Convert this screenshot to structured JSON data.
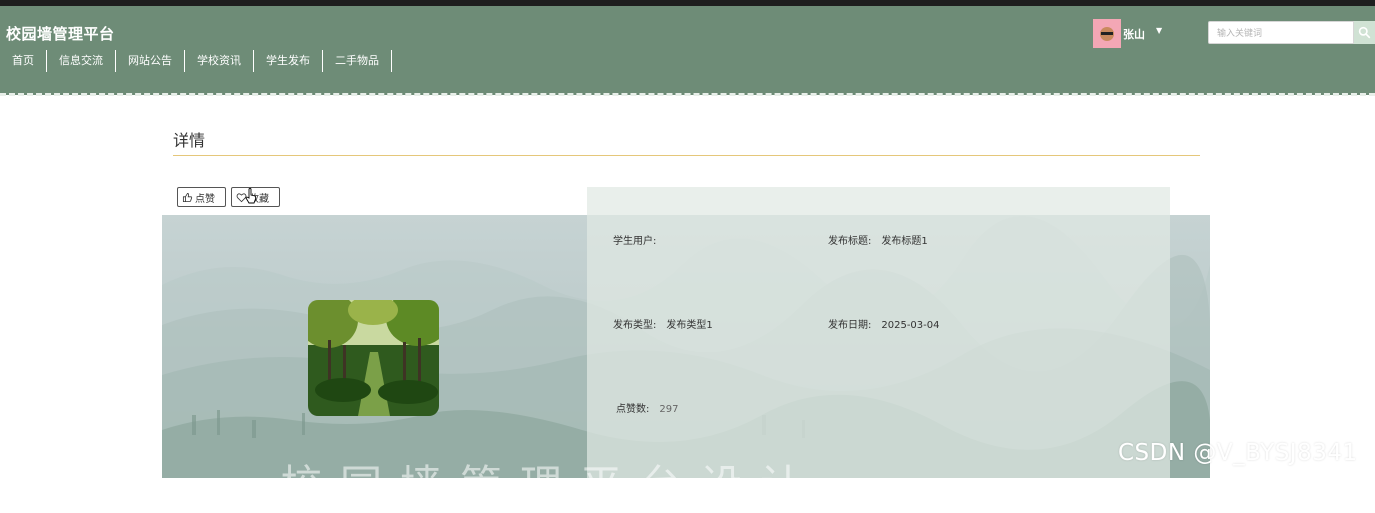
{
  "header": {
    "site_title": "校园墙管理平台",
    "nav": [
      "首页",
      "信息交流",
      "网站公告",
      "学校资讯",
      "学生发布",
      "二手物品"
    ],
    "user": {
      "name": "张山",
      "avatar_color": "#f3a7b5"
    },
    "search": {
      "placeholder": "输入关键词"
    },
    "background_color": "#6e8c77"
  },
  "page": {
    "title": "详情",
    "actions": {
      "like_label": "点赞",
      "favorite_label": "收藏"
    }
  },
  "detail": {
    "student_user": {
      "label": "学生用户:",
      "value": ""
    },
    "publish_title": {
      "label": "发布标题:",
      "value": "发布标题1"
    },
    "publish_type": {
      "label": "发布类型:",
      "value": "发布类型1"
    },
    "publish_date": {
      "label": "发布日期:",
      "value": "2025-03-04"
    },
    "like_count": {
      "label": "点赞数:",
      "value": "297"
    }
  },
  "watermark": {
    "faded_text": "校园墙管理平台设计",
    "csdn": "CSDN @V_BYSJ8341"
  }
}
